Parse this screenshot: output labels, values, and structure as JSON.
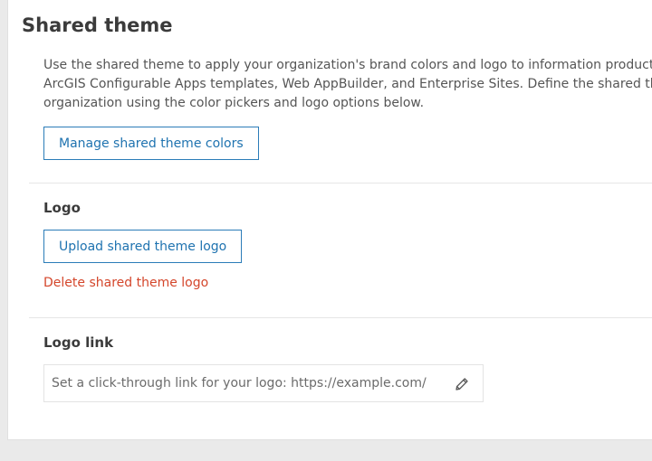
{
  "section": {
    "title": "Shared theme",
    "description_lines": [
      "Use the shared theme to apply your organization's brand colors and logo to information products c",
      "ArcGIS Configurable Apps templates, Web AppBuilder, and Enterprise Sites. Define the shared ther",
      "organization using the color pickers and logo options below."
    ],
    "manage_colors_label": "Manage shared theme colors"
  },
  "logo": {
    "heading": "Logo",
    "upload_label": "Upload shared theme logo",
    "delete_label": "Delete shared theme logo"
  },
  "logo_link": {
    "heading": "Logo link",
    "placeholder": "Set a click-through link for your logo: https://example.com/",
    "edit_icon": "pencil-icon"
  },
  "colors": {
    "accent": "#1f73b0",
    "danger": "#d4462b"
  }
}
